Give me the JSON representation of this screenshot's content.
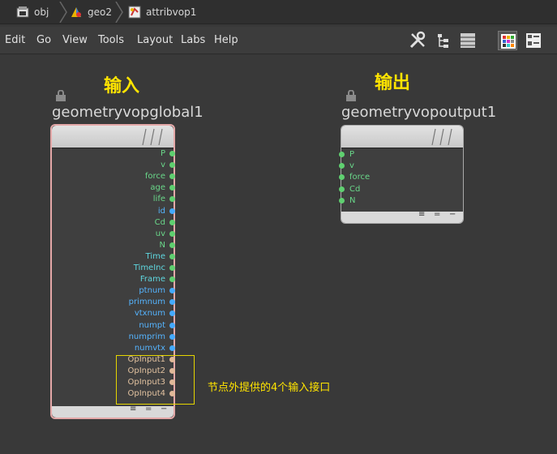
{
  "breadcrumb": [
    {
      "label": "obj",
      "icon": "obj-context-icon"
    },
    {
      "label": "geo2",
      "icon": "geometry-node-icon"
    },
    {
      "label": "attribvop1",
      "icon": "vop-network-icon"
    }
  ],
  "menu": [
    "Edit",
    "Go",
    "View",
    "Tools",
    "Layout",
    "Labs",
    "Help"
  ],
  "toolbar_icons": [
    "wrench-icon",
    "tree-icon",
    "list-icon",
    "color-palette-icon",
    "node-shapes-icon"
  ],
  "colors": {
    "annotation": "#ffe400",
    "port_green": "#5fd070",
    "port_blue": "#44aaff",
    "port_tan": "#e0b898",
    "label_green": "#6ad88a",
    "label_cyan": "#5fd8e0",
    "label_blue": "#55b4ff",
    "label_tan": "#e2c2a0"
  },
  "input_node": {
    "caption": "输入",
    "name": "geometryvopglobal1",
    "outputs": [
      {
        "label": "P",
        "kind": "green"
      },
      {
        "label": "v",
        "kind": "green"
      },
      {
        "label": "force",
        "kind": "green"
      },
      {
        "label": "age",
        "kind": "green"
      },
      {
        "label": "life",
        "kind": "green"
      },
      {
        "label": "id",
        "kind": "blue"
      },
      {
        "label": "Cd",
        "kind": "green"
      },
      {
        "label": "uv",
        "kind": "green"
      },
      {
        "label": "N",
        "kind": "green"
      },
      {
        "label": "Time",
        "kind": "cyan"
      },
      {
        "label": "TimeInc",
        "kind": "cyan"
      },
      {
        "label": "Frame",
        "kind": "cyan"
      },
      {
        "label": "ptnum",
        "kind": "blue"
      },
      {
        "label": "primnum",
        "kind": "blue"
      },
      {
        "label": "vtxnum",
        "kind": "blue"
      },
      {
        "label": "numpt",
        "kind": "blue"
      },
      {
        "label": "numprim",
        "kind": "blue"
      },
      {
        "label": "numvtx",
        "kind": "blue"
      },
      {
        "label": "OpInput1",
        "kind": "tan"
      },
      {
        "label": "OpInput2",
        "kind": "tan"
      },
      {
        "label": "OpInput3",
        "kind": "tan"
      },
      {
        "label": "OpInput4",
        "kind": "tan"
      }
    ]
  },
  "output_node": {
    "caption": "输出",
    "name": "geometryvopoutput1",
    "inputs": [
      {
        "label": "P",
        "kind": "green"
      },
      {
        "label": "v",
        "kind": "green"
      },
      {
        "label": "force",
        "kind": "green"
      },
      {
        "label": "Cd",
        "kind": "green"
      },
      {
        "label": "N",
        "kind": "green"
      }
    ]
  },
  "annotation": "节点外提供的4个输入接口"
}
